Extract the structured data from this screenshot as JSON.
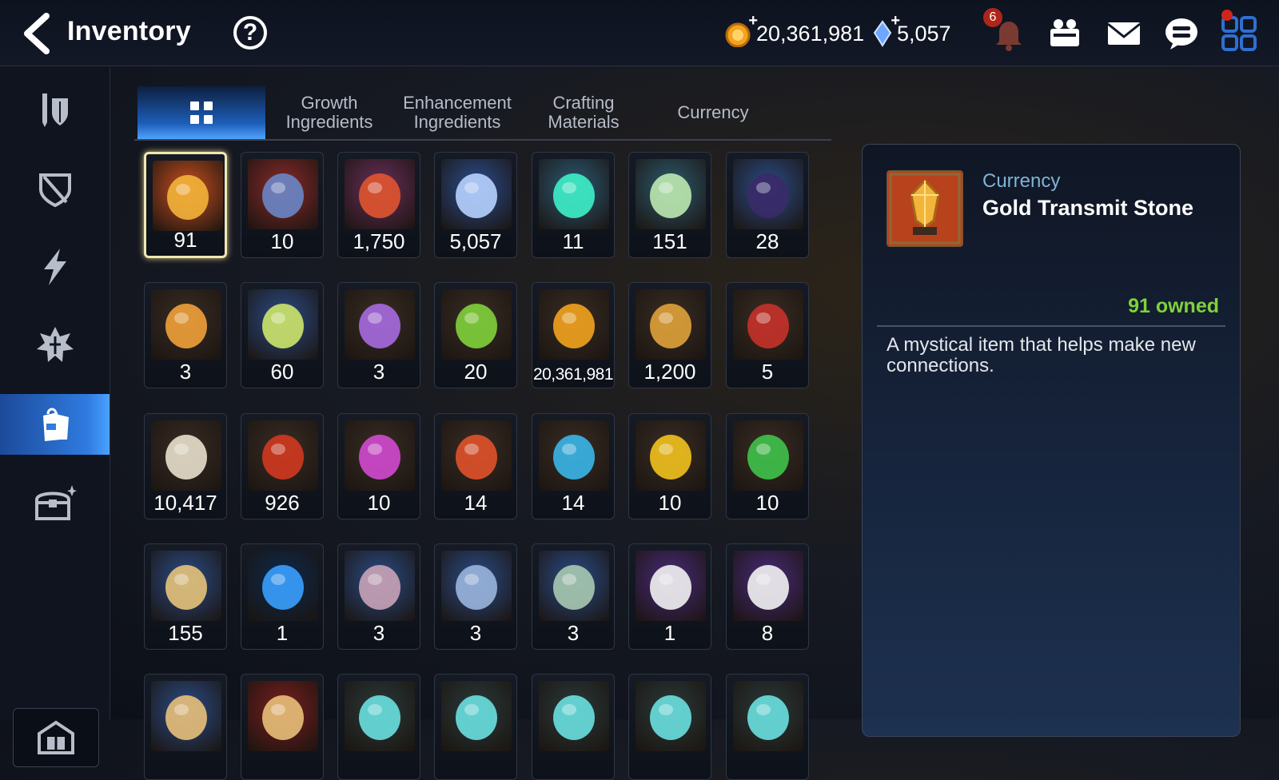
{
  "header": {
    "title": "Inventory",
    "help_label": "?",
    "gold": "20,361,981",
    "crystals": "5,057",
    "notification_count": "6"
  },
  "tabs": [
    {
      "label": "",
      "icon": "grid-icon",
      "active": true
    },
    {
      "label": "Growth\nIngredients"
    },
    {
      "label": "Enhancement\nIngredients"
    },
    {
      "label": "Crafting\nMaterials"
    },
    {
      "label": "Currency"
    }
  ],
  "sidebar": {
    "items": [
      {
        "icon": "hero-equipment-icon"
      },
      {
        "icon": "shield-icon"
      },
      {
        "icon": "lightning-icon"
      },
      {
        "icon": "artifact-icon"
      },
      {
        "icon": "bag-icon",
        "active": true
      },
      {
        "icon": "chest-icon"
      }
    ],
    "bottom_icon": "storage-icon"
  },
  "items": [
    {
      "qty": "91",
      "icon": "gold-transmit-stone",
      "colors": [
        "#c94f1f",
        "#f3b43a"
      ],
      "selected": true
    },
    {
      "qty": "10",
      "icon": "dark-ring",
      "colors": [
        "#8a2a2a",
        "#6a86c7"
      ]
    },
    {
      "qty": "1,750",
      "icon": "red-ring",
      "colors": [
        "#6a2e5a",
        "#e0552f"
      ]
    },
    {
      "qty": "5,057",
      "icon": "blue-crystal",
      "colors": [
        "#2b4d8e",
        "#b7d2ff"
      ]
    },
    {
      "qty": "11",
      "icon": "teal-crystal",
      "colors": [
        "#2b5a76",
        "#3ef0c8"
      ]
    },
    {
      "qty": "151",
      "icon": "leaf",
      "colors": [
        "#2d5a6f",
        "#bde9b0"
      ]
    },
    {
      "qty": "28",
      "icon": "pet-card",
      "colors": [
        "#2b4c87",
        "#3a2a6a"
      ]
    },
    {
      "qty": "3",
      "icon": "star-charm",
      "colors": [
        "#3a2d25",
        "#f0a13a"
      ]
    },
    {
      "qty": "60",
      "icon": "card",
      "colors": [
        "#2b4c87",
        "#cde66a"
      ]
    },
    {
      "qty": "3",
      "icon": "purple-badge",
      "colors": [
        "#3a2d25",
        "#a76ae0"
      ]
    },
    {
      "qty": "20",
      "icon": "green-heart",
      "colors": [
        "#3a2d25",
        "#7fd13b"
      ]
    },
    {
      "qty": "20,361,981",
      "icon": "gold-coin",
      "colors": [
        "#3a2d25",
        "#f3a31e"
      ]
    },
    {
      "qty": "1,200",
      "icon": "fist-emblem",
      "colors": [
        "#3a2d25",
        "#e0a23a"
      ]
    },
    {
      "qty": "5",
      "icon": "red-banner",
      "colors": [
        "#3a2d25",
        "#c6322a"
      ]
    },
    {
      "qty": "10,417",
      "icon": "knight-piece",
      "colors": [
        "#3a2d25",
        "#e8e0cc"
      ]
    },
    {
      "qty": "926",
      "icon": "red-leaf",
      "colors": [
        "#3a2d25",
        "#d2381f"
      ]
    },
    {
      "qty": "10",
      "icon": "pink-rune",
      "colors": [
        "#3a2d25",
        "#d24ad0"
      ]
    },
    {
      "qty": "14",
      "icon": "red-rune",
      "colors": [
        "#3a2d25",
        "#e0522a"
      ]
    },
    {
      "qty": "14",
      "icon": "blue-rune",
      "colors": [
        "#3a2d25",
        "#3ab6e8"
      ]
    },
    {
      "qty": "10",
      "icon": "yellow-rune",
      "colors": [
        "#3a2d25",
        "#f2c21e"
      ]
    },
    {
      "qty": "10",
      "icon": "green-rune",
      "colors": [
        "#3a2d25",
        "#3fc24a"
      ]
    },
    {
      "qty": "155",
      "icon": "ginseng",
      "colors": [
        "#2b4c87",
        "#e6c37a"
      ]
    },
    {
      "qty": "1",
      "icon": "blue-sigil",
      "colors": [
        "#0c2a4e",
        "#3aa0ff"
      ]
    },
    {
      "qty": "3",
      "icon": "red-gem-box",
      "colors": [
        "#2b4c87",
        "#c9a3b7"
      ]
    },
    {
      "qty": "3",
      "icon": "blue-gem-box",
      "colors": [
        "#2b4c87",
        "#9ab5dd"
      ]
    },
    {
      "qty": "3",
      "icon": "green-gem-box",
      "colors": [
        "#2b4c87",
        "#a8c9b0"
      ]
    },
    {
      "qty": "1",
      "icon": "pet-food-bag",
      "colors": [
        "#4a2a7a",
        "#f2f2f2"
      ]
    },
    {
      "qty": "8",
      "icon": "pet-food-bag",
      "colors": [
        "#4a2a7a",
        "#f2f2f2"
      ]
    },
    {
      "qty": "",
      "icon": "partial-item",
      "colors": [
        "#2b4c87",
        "#e8c07a"
      ]
    },
    {
      "qty": "",
      "icon": "partial-item",
      "colors": [
        "#7a1e1e",
        "#e8c07a"
      ]
    },
    {
      "qty": "",
      "icon": "partial-item",
      "colors": [
        "#2a3a3a",
        "#6ae0e0"
      ]
    },
    {
      "qty": "",
      "icon": "partial-item",
      "colors": [
        "#2a3a3a",
        "#6ae0e0"
      ]
    },
    {
      "qty": "",
      "icon": "partial-item",
      "colors": [
        "#2a3a3a",
        "#6ae0e0"
      ]
    },
    {
      "qty": "",
      "icon": "partial-item",
      "colors": [
        "#2a3a3a",
        "#6ae0e0"
      ]
    },
    {
      "qty": "",
      "icon": "partial-item",
      "colors": [
        "#2a3a3a",
        "#6ae0e0"
      ]
    }
  ],
  "detail": {
    "category": "Currency",
    "name": "Gold Transmit Stone",
    "owned": "91 owned",
    "description": "A mystical item that helps make new connections."
  },
  "colors": {
    "accent": "#2f7be0",
    "owned_green": "#7fd13b",
    "selected_border": "#f0e7b2"
  }
}
